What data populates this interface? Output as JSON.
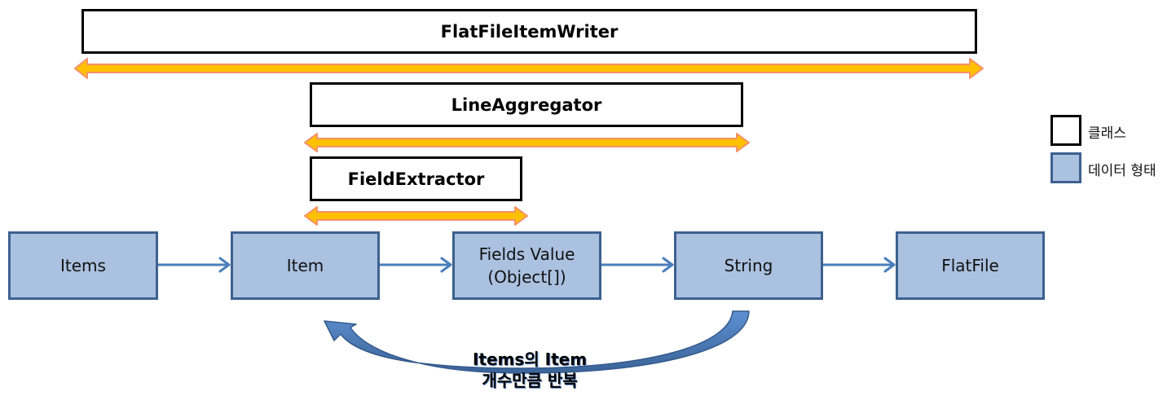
{
  "classes": {
    "flat_file_item_writer": "FlatFileItemWriter",
    "line_aggregator": "LineAggregator",
    "field_extractor": "FieldExtractor"
  },
  "data_nodes": [
    {
      "id": "items",
      "lines": [
        "Items"
      ]
    },
    {
      "id": "item",
      "lines": [
        "Item"
      ]
    },
    {
      "id": "fields-value",
      "lines": [
        "Fields Value",
        "(Object[])"
      ]
    },
    {
      "id": "string",
      "lines": [
        "String"
      ]
    },
    {
      "id": "flatfile",
      "lines": [
        "FlatFile"
      ]
    }
  ],
  "flow": [
    "Items",
    "Item",
    "Fields Value (Object[])",
    "String",
    "FlatFile"
  ],
  "loop": {
    "from": "String",
    "to": "Item",
    "label_line1": "Items의 Item",
    "label_line2": "개수만큼 반복"
  },
  "legend": {
    "class_label": "클래스",
    "data_label": "데이터 형태"
  },
  "colors": {
    "class_border": "#000000",
    "data_fill": "#abc1e0",
    "data_border": "#3d6190",
    "span_arrow_fill": "#ffc000",
    "span_arrow_outline": "#f28a5c",
    "flow_arrow": "#4a7ebb",
    "loop_arrow": "#4f7fbf"
  }
}
